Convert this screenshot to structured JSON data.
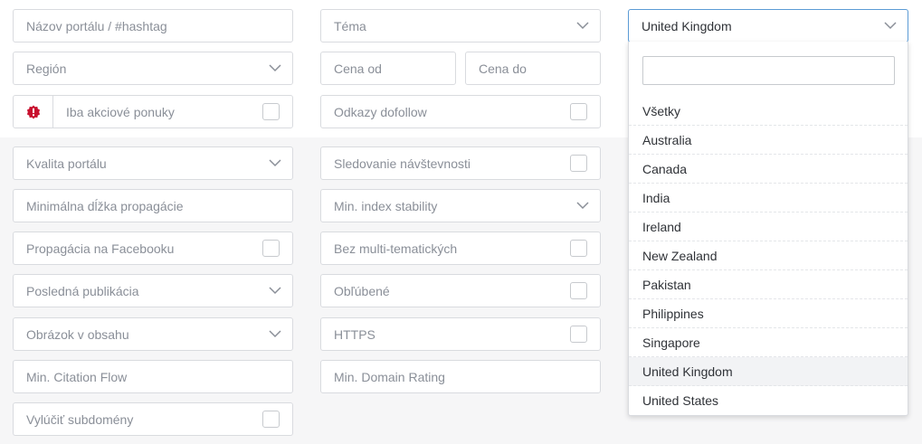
{
  "filters": {
    "portal_name": {
      "placeholder": "Názov portálu / #hashtag"
    },
    "theme": {
      "label": "Téma"
    },
    "region": {
      "label": "Región"
    },
    "price_from": {
      "placeholder": "Cena od"
    },
    "price_to": {
      "placeholder": "Cena do"
    },
    "sale_only": {
      "label": "Iba akciové ponuky",
      "accent_color": "#c8102e"
    },
    "dofollow": {
      "label": "Odkazy dofollow"
    },
    "portal_quality": {
      "label": "Kvalita portálu"
    },
    "traffic_tracking": {
      "label": "Sledovanie návštevnosti"
    },
    "min_promo_length": {
      "placeholder": "Minimálna dĺžka propagácie"
    },
    "min_index_stability": {
      "label": "Min. index stability"
    },
    "facebook_promo": {
      "label": "Propagácia na Facebooku"
    },
    "no_multi_topic": {
      "label": "Bez multi-tematických"
    },
    "last_publication": {
      "label": "Posledná publikácia"
    },
    "favorites": {
      "label": "Obľúbené"
    },
    "image_in_content": {
      "label": "Obrázok v obsahu"
    },
    "https": {
      "label": "HTTPS"
    },
    "min_citation_flow": {
      "placeholder": "Min. Citation Flow"
    },
    "min_domain_rating": {
      "placeholder": "Min. Domain Rating"
    },
    "exclude_subdomains": {
      "label": "Vylúčiť subdomény"
    }
  },
  "country": {
    "selected": "United Kingdom",
    "search_value": "",
    "options": [
      "Všetky",
      "Australia",
      "Canada",
      "India",
      "Ireland",
      "New Zealand",
      "Pakistan",
      "Philippines",
      "Singapore",
      "United Kingdom",
      "United States"
    ]
  },
  "colors": {
    "border": "#d9dbdf",
    "focus_border": "#5b9bd5",
    "placeholder_text": "#8a8f98",
    "selected_text": "#2f3237",
    "grey_band": "#f6f6f7"
  }
}
